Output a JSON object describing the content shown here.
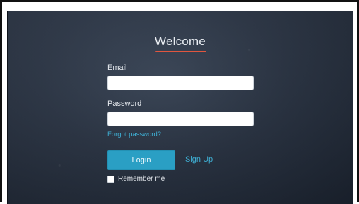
{
  "login": {
    "title": "Welcome",
    "email_label": "Email",
    "email_value": "",
    "password_label": "Password",
    "password_value": "",
    "forgot_link": "Forgot password?",
    "login_button": "Login",
    "signup_link": "Sign Up",
    "remember_label": "Remember me",
    "remember_checked": false
  },
  "colors": {
    "accent": "#2a9fc4",
    "link": "#3fb1d6",
    "title_underline": "#e0563f",
    "background": "#2a3444"
  }
}
